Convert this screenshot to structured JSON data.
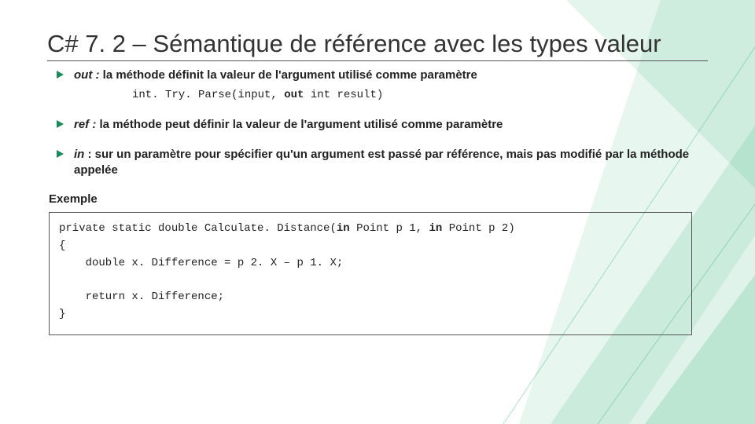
{
  "title": "C# 7. 2 – Sémantique de référence avec les types valeur",
  "bullets": [
    {
      "lead": "out :",
      "rest": " la méthode définit la valeur de l'argument utilisé comme paramètre",
      "code_pre": "int. Try. Parse(input, ",
      "code_bold": "out",
      "code_post": " int result)"
    },
    {
      "lead": "ref :",
      "rest": " la méthode peut définir la valeur de l'argument utilisé comme paramètre"
    },
    {
      "lead": "in",
      "rest": " : sur un paramètre pour spécifier qu'un argument est passé par référence, mais pas modifié par la méthode appelée"
    }
  ],
  "example_label": "Exemple",
  "code": {
    "l1a": "private static double Calculate. Distance(",
    "l1b1": "in",
    "l1c": " Point p 1, ",
    "l1b2": "in",
    "l1d": " Point p 2)",
    "l2": "{",
    "l3": "    double x. Difference = p 2. X – p 1. X;",
    "l4": "",
    "l5": "    return x. Difference;",
    "l6": "}"
  }
}
